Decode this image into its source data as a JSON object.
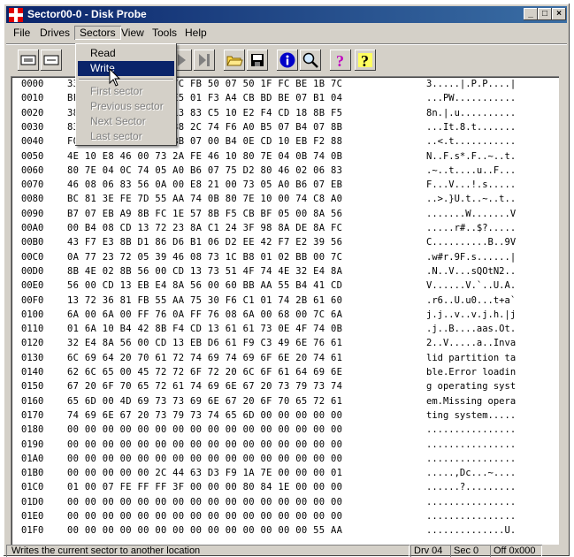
{
  "window": {
    "title": "Sector00-0 - Disk Probe"
  },
  "menu": [
    "File",
    "Drives",
    "Sectors",
    "View",
    "Tools",
    "Help"
  ],
  "sectors_menu": {
    "items": [
      {
        "label": "Read",
        "enabled": true
      },
      {
        "label": "Write",
        "enabled": true,
        "highlighted": true
      },
      {
        "label": "First sector",
        "enabled": false
      },
      {
        "label": "Previous sector",
        "enabled": false
      },
      {
        "label": "Next Sector",
        "enabled": false
      },
      {
        "label": "Last sector",
        "enabled": false
      }
    ]
  },
  "toolbar": [
    "sector-view-icon",
    "partition-view-icon",
    "boot-view-icon",
    "first-icon",
    "prev-icon",
    "next-icon",
    "last-icon",
    "open-folder-icon",
    "save-icon",
    "info-icon",
    "search-icon",
    "help-icon",
    "context-help-icon"
  ],
  "hex_rows": [
    {
      "offset": "0000",
      "bytes": "33 C0 8E D0 BC 00 7C FB 50 07 50 1F FC BE 1B 7C",
      "ascii": "3.....|.P.P....|"
    },
    {
      "offset": "0010",
      "bytes": "BF 1B 06 50 57 B9 E5 01 F3 A4 CB BD BE 07 B1 04",
      "ascii": "...PW..........."
    },
    {
      "offset": "0020",
      "bytes": "38 6E 00 7C 09 75 13 83 C5 10 E2 F4 CD 18 8B F5",
      "ascii": "8n.|.u.........."
    },
    {
      "offset": "0030",
      "bytes": "83 C6 10 49 74 19 38 2C 74 F6 A0 B5 07 B4 07 8B",
      "ascii": "...It.8.t......."
    },
    {
      "offset": "0040",
      "bytes": "F0 AC 3C 00 74 FC BB 07 00 B4 0E CD 10 EB F2 88",
      "ascii": "..<.t..........."
    },
    {
      "offset": "0050",
      "bytes": "4E 10 E8 46 00 73 2A FE 46 10 80 7E 04 0B 74 0B",
      "ascii": "N..F.s*.F..~..t."
    },
    {
      "offset": "0060",
      "bytes": "80 7E 04 0C 74 05 A0 B6 07 75 D2 80 46 02 06 83",
      "ascii": ".~..t....u..F..."
    },
    {
      "offset": "0070",
      "bytes": "46 08 06 83 56 0A 00 E8 21 00 73 05 A0 B6 07 EB",
      "ascii": "F...V...!.s....."
    },
    {
      "offset": "0080",
      "bytes": "BC 81 3E FE 7D 55 AA 74 0B 80 7E 10 00 74 C8 A0",
      "ascii": "..>.}U.t..~..t.."
    },
    {
      "offset": "0090",
      "bytes": "B7 07 EB A9 8B FC 1E 57 8B F5 CB BF 05 00 8A 56",
      "ascii": ".......W.......V"
    },
    {
      "offset": "00A0",
      "bytes": "00 B4 08 CD 13 72 23 8A C1 24 3F 98 8A DE 8A FC",
      "ascii": ".....r#..$?....."
    },
    {
      "offset": "00B0",
      "bytes": "43 F7 E3 8B D1 86 D6 B1 06 D2 EE 42 F7 E2 39 56",
      "ascii": "C..........B..9V"
    },
    {
      "offset": "00C0",
      "bytes": "0A 77 23 72 05 39 46 08 73 1C B8 01 02 BB 00 7C",
      "ascii": ".w#r.9F.s......|"
    },
    {
      "offset": "00D0",
      "bytes": "8B 4E 02 8B 56 00 CD 13 73 51 4F 74 4E 32 E4 8A",
      "ascii": ".N..V...sQOtN2.."
    },
    {
      "offset": "00E0",
      "bytes": "56 00 CD 13 EB E4 8A 56 00 60 BB AA 55 B4 41 CD",
      "ascii": "V......V.`..U.A."
    },
    {
      "offset": "00F0",
      "bytes": "13 72 36 81 FB 55 AA 75 30 F6 C1 01 74 2B 61 60",
      "ascii": ".r6..U.u0...t+a`"
    },
    {
      "offset": "0100",
      "bytes": "6A 00 6A 00 FF 76 0A FF 76 08 6A 00 68 00 7C 6A",
      "ascii": "j.j..v..v.j.h.|j"
    },
    {
      "offset": "0110",
      "bytes": "01 6A 10 B4 42 8B F4 CD 13 61 61 73 0E 4F 74 0B",
      "ascii": ".j..B....aas.Ot."
    },
    {
      "offset": "0120",
      "bytes": "32 E4 8A 56 00 CD 13 EB D6 61 F9 C3 49 6E 76 61",
      "ascii": "2..V.....a..Inva"
    },
    {
      "offset": "0130",
      "bytes": "6C 69 64 20 70 61 72 74 69 74 69 6F 6E 20 74 61",
      "ascii": "lid partition ta"
    },
    {
      "offset": "0140",
      "bytes": "62 6C 65 00 45 72 72 6F 72 20 6C 6F 61 64 69 6E",
      "ascii": "ble.Error loadin"
    },
    {
      "offset": "0150",
      "bytes": "67 20 6F 70 65 72 61 74 69 6E 67 20 73 79 73 74",
      "ascii": "g operating syst"
    },
    {
      "offset": "0160",
      "bytes": "65 6D 00 4D 69 73 73 69 6E 67 20 6F 70 65 72 61",
      "ascii": "em.Missing opera"
    },
    {
      "offset": "0170",
      "bytes": "74 69 6E 67 20 73 79 73 74 65 6D 00 00 00 00 00",
      "ascii": "ting system....."
    },
    {
      "offset": "0180",
      "bytes": "00 00 00 00 00 00 00 00 00 00 00 00 00 00 00 00",
      "ascii": "................"
    },
    {
      "offset": "0190",
      "bytes": "00 00 00 00 00 00 00 00 00 00 00 00 00 00 00 00",
      "ascii": "................"
    },
    {
      "offset": "01A0",
      "bytes": "00 00 00 00 00 00 00 00 00 00 00 00 00 00 00 00",
      "ascii": "................"
    },
    {
      "offset": "01B0",
      "bytes": "00 00 00 00 00 2C 44 63 D3 F9 1A 7E 00 00 00 01",
      "ascii": ".....,Dc...~...."
    },
    {
      "offset": "01C0",
      "bytes": "01 00 07 FE FF FF 3F 00 00 00 80 84 1E 00 00 00",
      "ascii": "......?........."
    },
    {
      "offset": "01D0",
      "bytes": "00 00 00 00 00 00 00 00 00 00 00 00 00 00 00 00",
      "ascii": "................"
    },
    {
      "offset": "01E0",
      "bytes": "00 00 00 00 00 00 00 00 00 00 00 00 00 00 00 00",
      "ascii": "................"
    },
    {
      "offset": "01F0",
      "bytes": "00 00 00 00 00 00 00 00 00 00 00 00 00 00 55 AA",
      "ascii": "..............U."
    }
  ],
  "status": {
    "message": "Writes the current sector to another location",
    "drive": "Drv 04",
    "sector": "Sec 0",
    "offset": "Off 0x000"
  }
}
